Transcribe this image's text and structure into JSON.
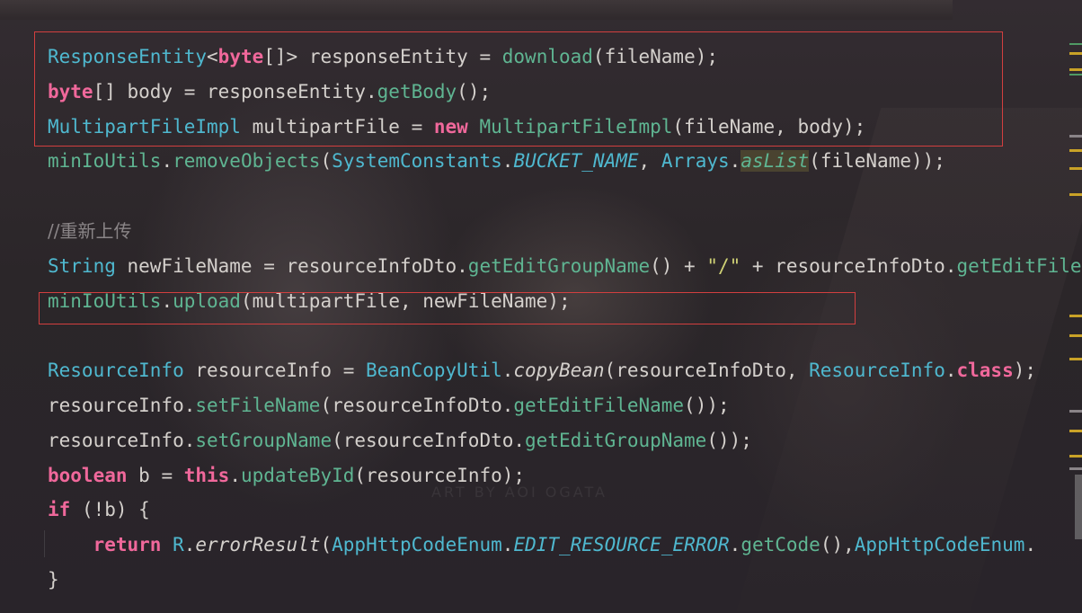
{
  "editor": {
    "lines": [
      {
        "tokens": [
          {
            "cls": "t",
            "text": "ResponseEntity"
          },
          {
            "cls": "",
            "text": "<"
          },
          {
            "cls": "k",
            "text": "byte"
          },
          {
            "cls": "",
            "text": "[]> responseEntity = "
          },
          {
            "cls": "m",
            "text": "download"
          },
          {
            "cls": "",
            "text": "(fileName);"
          }
        ]
      },
      {
        "tokens": [
          {
            "cls": "k",
            "text": "byte"
          },
          {
            "cls": "",
            "text": "[] body = responseEntity."
          },
          {
            "cls": "m",
            "text": "getBody"
          },
          {
            "cls": "",
            "text": "();"
          }
        ]
      },
      {
        "tokens": [
          {
            "cls": "t",
            "text": "MultipartFileImpl"
          },
          {
            "cls": "",
            "text": " multipartFile = "
          },
          {
            "cls": "k",
            "text": "new "
          },
          {
            "cls": "m",
            "text": "MultipartFileImpl"
          },
          {
            "cls": "",
            "text": "(fileName, body);"
          }
        ]
      },
      {
        "tokens": [
          {
            "cls": "m",
            "text": "minIoUtils"
          },
          {
            "cls": "",
            "text": "."
          },
          {
            "cls": "m",
            "text": "removeObjects"
          },
          {
            "cls": "",
            "text": "("
          },
          {
            "cls": "t",
            "text": "SystemConstants"
          },
          {
            "cls": "",
            "text": "."
          },
          {
            "cls": "sf",
            "text": "BUCKET_NAME"
          },
          {
            "cls": "",
            "text": ", "
          },
          {
            "cls": "t",
            "text": "Arrays"
          },
          {
            "cls": "",
            "text": "."
          },
          {
            "cls": "sm hl",
            "text": "asList"
          },
          {
            "cls": "",
            "text": "(fileName));"
          }
        ]
      },
      {
        "tokens": []
      },
      {
        "tokens": [
          {
            "cls": "c",
            "text": "//重新上传"
          }
        ]
      },
      {
        "tokens": [
          {
            "cls": "t",
            "text": "String"
          },
          {
            "cls": "",
            "text": " newFileName = resourceInfoDto."
          },
          {
            "cls": "m",
            "text": "getEditGroupName"
          },
          {
            "cls": "",
            "text": "() + "
          },
          {
            "cls": "s",
            "text": "\"/\""
          },
          {
            "cls": "",
            "text": " + resourceInfoDto."
          },
          {
            "cls": "m",
            "text": "getEditFileName"
          },
          {
            "cls": "",
            "text": "();"
          }
        ]
      },
      {
        "tokens": [
          {
            "cls": "m",
            "text": "minIoUtils"
          },
          {
            "cls": "",
            "text": "."
          },
          {
            "cls": "m",
            "text": "upload"
          },
          {
            "cls": "",
            "text": "(multipartFile, newFileName);"
          }
        ]
      },
      {
        "tokens": []
      },
      {
        "tokens": [
          {
            "cls": "t",
            "text": "ResourceInfo"
          },
          {
            "cls": "",
            "text": " resourceInfo = "
          },
          {
            "cls": "t",
            "text": "BeanCopyUtil"
          },
          {
            "cls": "",
            "text": "."
          },
          {
            "cls": "i",
            "text": "copyBean"
          },
          {
            "cls": "",
            "text": "(resourceInfoDto, "
          },
          {
            "cls": "t",
            "text": "ResourceInfo"
          },
          {
            "cls": "",
            "text": "."
          },
          {
            "cls": "k",
            "text": "class"
          },
          {
            "cls": "",
            "text": ");"
          }
        ]
      },
      {
        "tokens": [
          {
            "cls": "",
            "text": "resourceInfo."
          },
          {
            "cls": "m",
            "text": "setFileName"
          },
          {
            "cls": "",
            "text": "(resourceInfoDto."
          },
          {
            "cls": "m",
            "text": "getEditFileName"
          },
          {
            "cls": "",
            "text": "());"
          }
        ]
      },
      {
        "tokens": [
          {
            "cls": "",
            "text": "resourceInfo."
          },
          {
            "cls": "m",
            "text": "setGroupName"
          },
          {
            "cls": "",
            "text": "(resourceInfoDto."
          },
          {
            "cls": "m",
            "text": "getEditGroupName"
          },
          {
            "cls": "",
            "text": "());"
          }
        ]
      },
      {
        "tokens": [
          {
            "cls": "k",
            "text": "boolean"
          },
          {
            "cls": "",
            "text": " b = "
          },
          {
            "cls": "k",
            "text": "this"
          },
          {
            "cls": "",
            "text": "."
          },
          {
            "cls": "m",
            "text": "updateById"
          },
          {
            "cls": "",
            "text": "(resourceInfo);"
          }
        ]
      },
      {
        "tokens": [
          {
            "cls": "k",
            "text": "if"
          },
          {
            "cls": "",
            "text": " (!b) {"
          }
        ]
      },
      {
        "tokens": [
          {
            "cls": "",
            "text": "    "
          },
          {
            "cls": "k",
            "text": "return "
          },
          {
            "cls": "t",
            "text": "R"
          },
          {
            "cls": "",
            "text": "."
          },
          {
            "cls": "i",
            "text": "errorResult"
          },
          {
            "cls": "",
            "text": "("
          },
          {
            "cls": "t",
            "text": "AppHttpCodeEnum"
          },
          {
            "cls": "",
            "text": "."
          },
          {
            "cls": "sf",
            "text": "EDIT_RESOURCE_ERROR"
          },
          {
            "cls": "",
            "text": "."
          },
          {
            "cls": "m",
            "text": "getCode"
          },
          {
            "cls": "",
            "text": "(),"
          },
          {
            "cls": "t",
            "text": "AppHttpCodeEnum"
          },
          {
            "cls": "",
            "text": "."
          }
        ]
      },
      {
        "tokens": [
          {
            "cls": "",
            "text": "}"
          }
        ]
      }
    ]
  },
  "theme": {
    "keyword": "#f0689b",
    "type": "#4fb8cf",
    "method": "#5fb592",
    "string": "#cfd175",
    "comment": "#8a8587",
    "plain": "#d4d0cc",
    "highlight_box": "#d23f3f",
    "gutter_warning": "#c9a227"
  },
  "watermark": {
    "text": "ART BY AOI OGATA"
  }
}
